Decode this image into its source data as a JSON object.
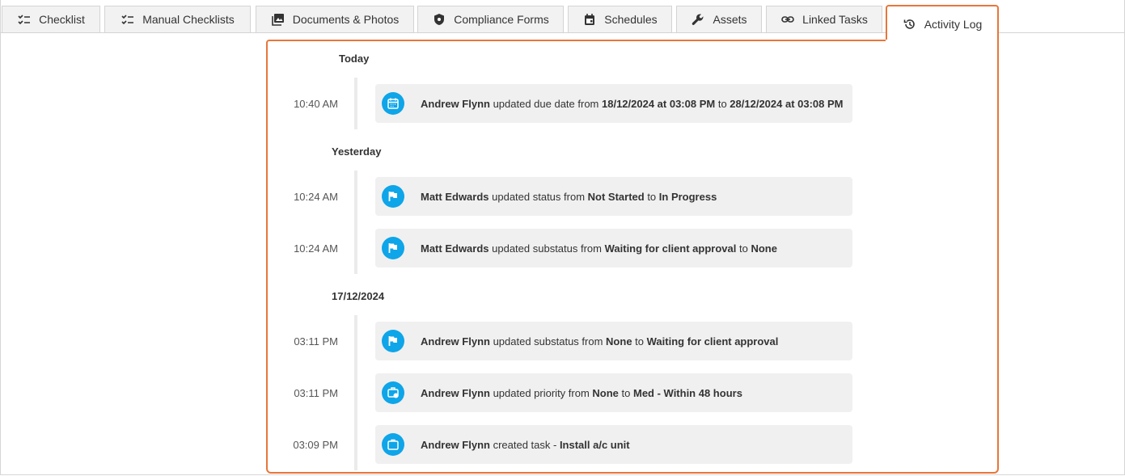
{
  "tabs": [
    {
      "label": "Checklist",
      "icon": "checklist-icon"
    },
    {
      "label": "Manual Checklists",
      "icon": "checklist-icon"
    },
    {
      "label": "Documents & Photos",
      "icon": "photo-icon"
    },
    {
      "label": "Compliance Forms",
      "icon": "shield-icon"
    },
    {
      "label": "Schedules",
      "icon": "calendar-icon"
    },
    {
      "label": "Assets",
      "icon": "wrench-icon"
    },
    {
      "label": "Linked Tasks",
      "icon": "link-icon"
    },
    {
      "label": "Activity Log",
      "icon": "history-icon",
      "active": true
    }
  ],
  "colors": {
    "accent": "#e8763a",
    "icon_bg": "#0ea5e9"
  },
  "activity": [
    {
      "day": "Today",
      "entries": [
        {
          "time": "10:40 AM",
          "icon": "calendar-icon",
          "user": "Andrew Flynn",
          "action": " updated due date from ",
          "from": "18/12/2024 at 03:08 PM",
          "sep": " to ",
          "to": "28/12/2024 at 03:08 PM"
        }
      ]
    },
    {
      "day": "Yesterday",
      "entries": [
        {
          "time": "10:24 AM",
          "icon": "flag-icon",
          "user": "Matt Edwards",
          "action": " updated status from ",
          "from": "Not Started",
          "sep": " to ",
          "to": "In Progress"
        },
        {
          "time": "10:24 AM",
          "icon": "flag-icon",
          "user": "Matt Edwards",
          "action": " updated substatus from ",
          "from": "Waiting for client approval",
          "sep": " to ",
          "to": "None"
        }
      ]
    },
    {
      "day": "17/12/2024",
      "entries": [
        {
          "time": "03:11 PM",
          "icon": "flag-icon",
          "user": "Andrew Flynn",
          "action": " updated substatus from ",
          "from": "None",
          "sep": " to ",
          "to": "Waiting for client approval"
        },
        {
          "time": "03:11 PM",
          "icon": "priority-icon",
          "user": "Andrew Flynn",
          "action": " updated priority from ",
          "from": "None",
          "sep": " to ",
          "to": "Med - Within 48 hours"
        },
        {
          "time": "03:09 PM",
          "icon": "briefcase-icon",
          "user": "Andrew Flynn",
          "action": " created task - ",
          "from": "Install a/c unit",
          "sep": "",
          "to": ""
        }
      ]
    }
  ]
}
